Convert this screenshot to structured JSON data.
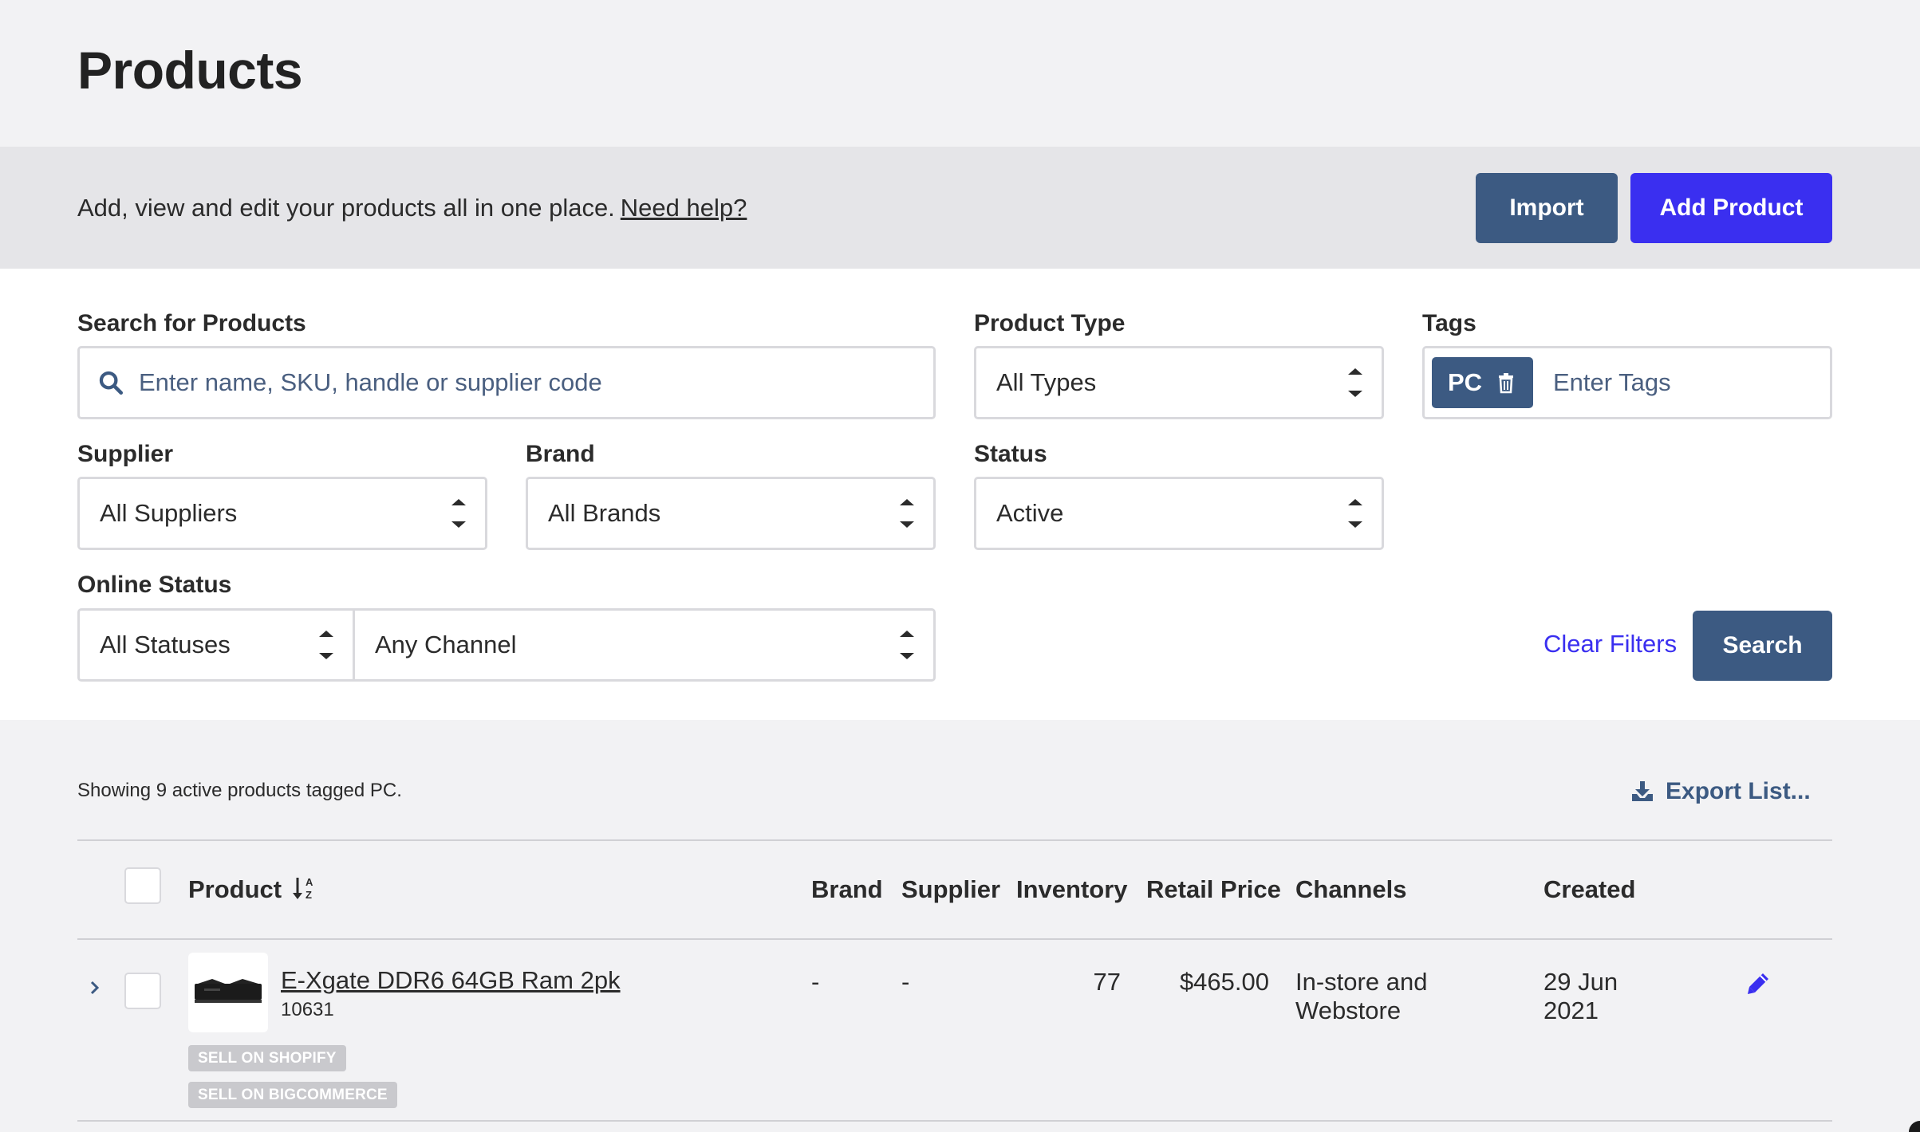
{
  "page": {
    "title": "Products"
  },
  "intro": {
    "text": "Add, view and edit your products all in one place.",
    "help_link": "Need help?"
  },
  "actions": {
    "import_label": "Import",
    "add_label": "Add Product"
  },
  "filters": {
    "search": {
      "label": "Search for Products",
      "placeholder": "Enter name, SKU, handle or supplier code"
    },
    "product_type": {
      "label": "Product Type",
      "value": "All Types"
    },
    "tags": {
      "label": "Tags",
      "chip": "PC",
      "placeholder": "Enter Tags"
    },
    "supplier": {
      "label": "Supplier",
      "value": "All Suppliers"
    },
    "brand": {
      "label": "Brand",
      "value": "All Brands"
    },
    "status": {
      "label": "Status",
      "value": "Active"
    },
    "online_status": {
      "label": "Online Status",
      "status_value": "All Statuses",
      "channel_value": "Any Channel"
    },
    "clear_label": "Clear Filters",
    "search_label": "Search"
  },
  "results": {
    "summary": "Showing 9 active products tagged PC.",
    "export_label": "Export List...",
    "columns": {
      "product": "Product",
      "brand": "Brand",
      "supplier": "Supplier",
      "inventory": "Inventory",
      "retail_price": "Retail Price",
      "channels": "Channels",
      "created": "Created"
    },
    "rows": [
      {
        "name": "E-Xgate DDR6 64GB Ram 2pk",
        "sku": "10631",
        "brand": "-",
        "supplier": "-",
        "inventory": "77",
        "retail_price": "$465.00",
        "channels_line1": "In-store and",
        "channels_line2": "Webstore",
        "created_line1": "29 Jun",
        "created_line2": "2021",
        "badges": [
          "SELL ON SHOPIFY",
          "SELL ON BIGCOMMERCE"
        ]
      }
    ]
  },
  "colors": {
    "primary": "#3a2ff0",
    "secondary": "#3c5a82",
    "background": "#f2f2f4",
    "bar": "#e5e5e8"
  }
}
